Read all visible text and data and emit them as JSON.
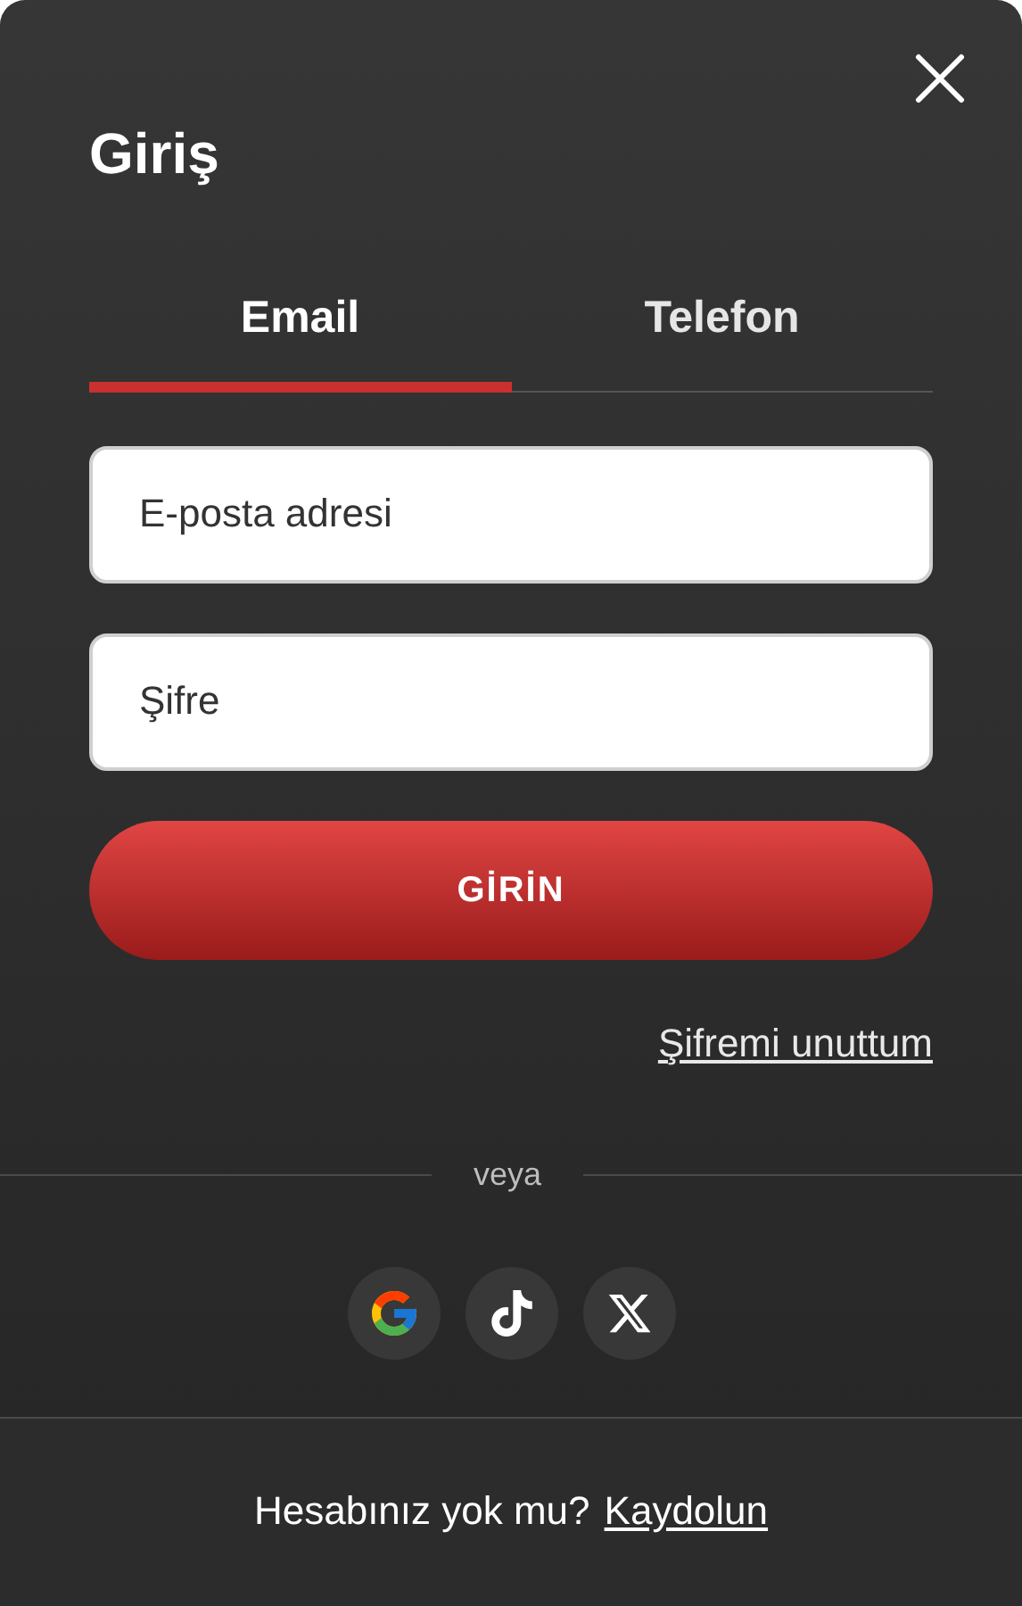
{
  "title": "Giriş",
  "tabs": [
    {
      "label": "Email",
      "selected": true
    },
    {
      "label": "Telefon",
      "selected": false
    }
  ],
  "fields": [
    {
      "placeholder": "E-posta adresi"
    },
    {
      "placeholder": "Şifre"
    }
  ],
  "submit": "GİRİN",
  "forgot_link": "Şifremi unuttum",
  "divider": "veya",
  "footer": {
    "text": "Hesabınız yok mu?",
    "link": "Kaydolun"
  }
}
